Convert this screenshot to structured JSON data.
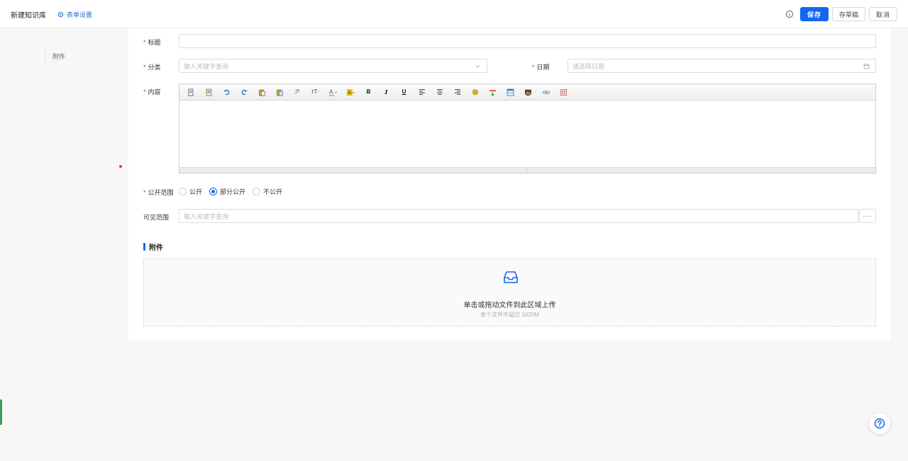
{
  "header": {
    "title": "新建知识库",
    "form_settings": "表单设置",
    "save": "保存",
    "draft": "存草稿",
    "cancel": "取消"
  },
  "sidebar": {
    "anchor": "附件"
  },
  "form": {
    "title_label": "标题",
    "category_label": "分类",
    "category_placeholder": "输入关键字查询",
    "date_label": "日期",
    "date_placeholder": "请选择日期",
    "content_label": "内容",
    "scope_label": "公开范围",
    "scope_options": [
      "公开",
      "部分公开",
      "不公开"
    ],
    "scope_selected": "部分公开",
    "visible_label": "可见范围",
    "visible_placeholder": "输入关键字查询"
  },
  "editor": {
    "tools": [
      "source-icon",
      "template-icon",
      "undo-icon",
      "redo-icon",
      "paste-icon",
      "paste-text-icon",
      "format-painter-icon",
      "font-size-icon",
      "font-color-icon",
      "highlight-icon",
      "bold-icon",
      "italic-icon",
      "underline-icon",
      "align-left-icon",
      "align-center-icon",
      "align-right-icon",
      "emoji-icon",
      "insert-icon",
      "table-icon",
      "image-icon",
      "link-icon",
      "fullscreen-icon"
    ]
  },
  "attachments": {
    "section_title": "附件",
    "upload_text": "单击或拖动文件到此区域上传",
    "upload_hint": "单个文件不超过 1020M"
  },
  "colors": {
    "primary": "#1466f2",
    "required": "#e8362f"
  }
}
